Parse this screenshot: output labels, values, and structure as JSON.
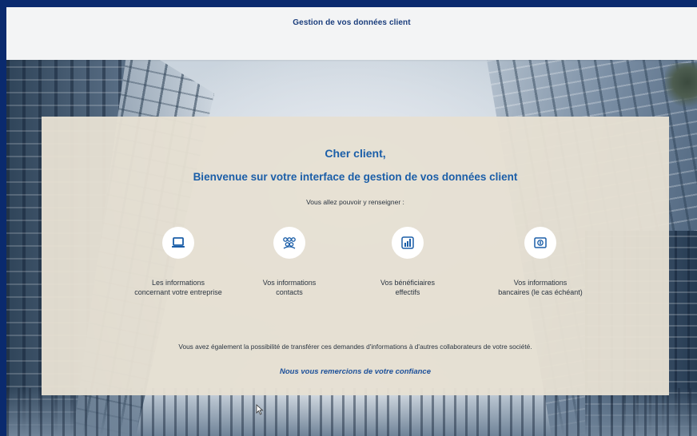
{
  "header": {
    "title": "Gestion de vos données client"
  },
  "card": {
    "greeting": "Cher client,",
    "welcome": "Bienvenue sur votre interface de gestion de vos données client",
    "subtitle": "Vous allez pouvoir y renseigner :",
    "features": [
      {
        "icon": "laptop-icon",
        "line1": "Les informations",
        "line2": "concernant votre entreprise"
      },
      {
        "icon": "users-icon",
        "line1": "Vos informations",
        "line2": "contacts"
      },
      {
        "icon": "bar-chart-icon",
        "line1": "Vos bénéficiaires",
        "line2": "effectifs"
      },
      {
        "icon": "bank-card-icon",
        "line1": "Vos informations",
        "line2": "bancaires (le cas échéant)"
      }
    ],
    "note": "Vous avez également la possibilité de transférer ces demandes d'informations à d'autres collaborateurs de votre société.",
    "thanks": "Nous vous remercions de votre confiance"
  },
  "colors": {
    "accent": "#1b5ea8",
    "frame": "#0a2a6e",
    "card": "#e6e0d2"
  }
}
